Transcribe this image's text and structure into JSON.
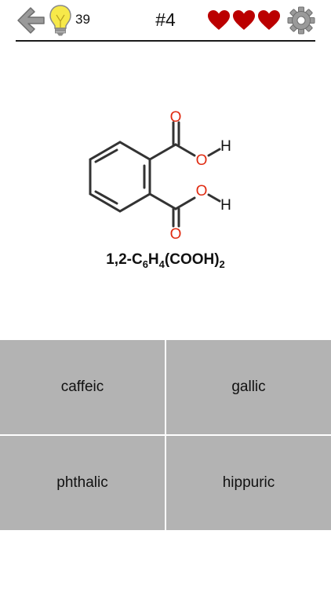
{
  "header": {
    "hint_count": "39",
    "question_number": "#4",
    "lives": 3,
    "colors": {
      "heart": "#bb0000",
      "bulb": "#f7e94a",
      "back_arrow": "#9a9a9a",
      "gear": "#9a9a9a"
    }
  },
  "question": {
    "atoms": {
      "oxygen": "O",
      "hydrogen": "H"
    },
    "formula": {
      "prefix": "1,2-C",
      "sub1": "6",
      "mid": "H",
      "sub2": "4",
      "group": "(COOH)",
      "sub3": "2"
    },
    "colors": {
      "oxygen": "#e02a10",
      "bond": "#333333"
    }
  },
  "answers": [
    {
      "label": "caffeic"
    },
    {
      "label": "gallic"
    },
    {
      "label": "phthalic"
    },
    {
      "label": "hippuric"
    }
  ],
  "colors": {
    "answer_bg": "#b3b3b3",
    "divider": "#ffffff"
  }
}
